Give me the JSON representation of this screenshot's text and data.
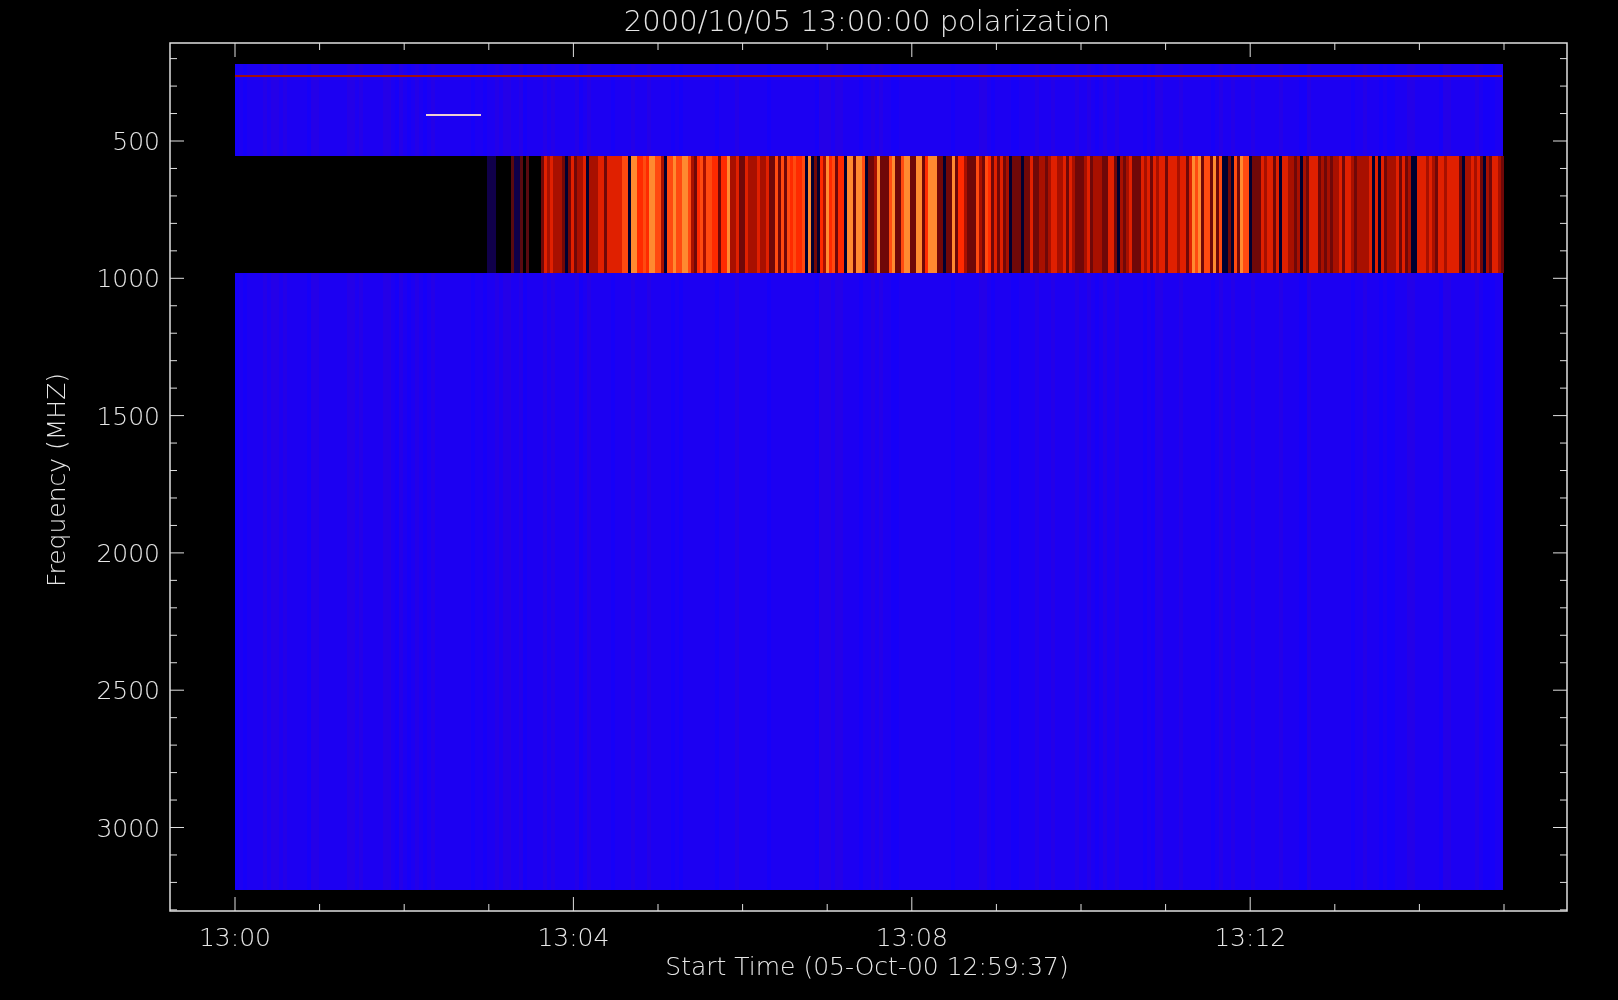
{
  "plot": {
    "title": "2000/10/05 13:00:00 polarization",
    "xlabel": "Start Time (05-Oct-00 12:59:37)",
    "ylabel": "Frequency (MHZ)",
    "xticks": [
      "13:00",
      "13:04",
      "13:08",
      "13:12"
    ],
    "yticks": [
      "500",
      "1000",
      "1500",
      "2000",
      "2500",
      "3000"
    ]
  }
}
